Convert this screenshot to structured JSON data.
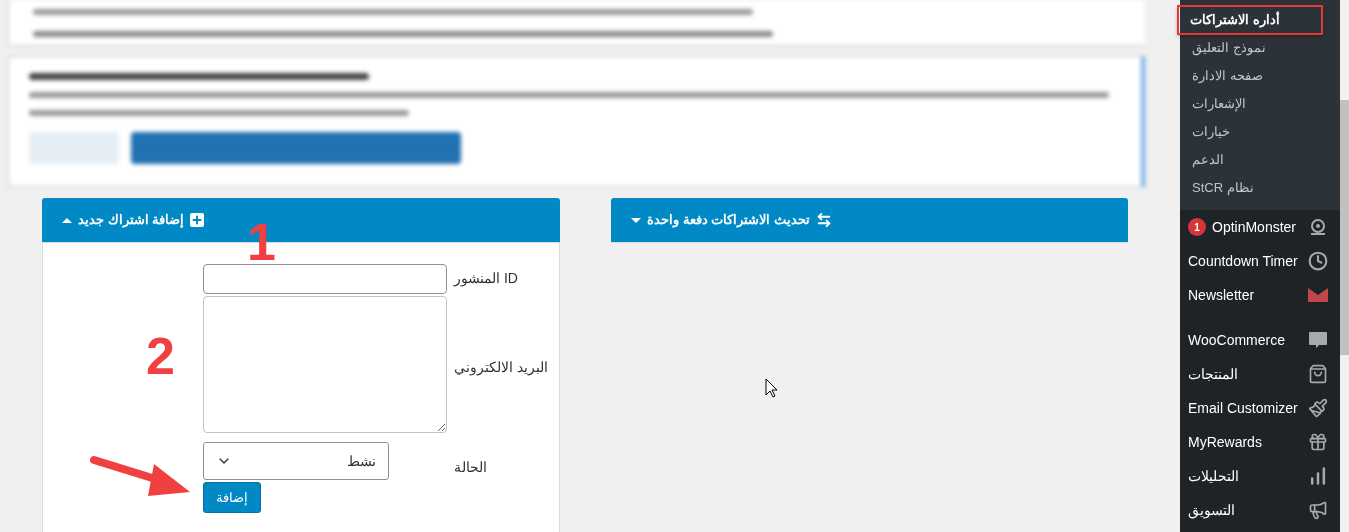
{
  "panels": [
    {
      "title": "تحديث الاشتراكات دفعة واحدة",
      "expanded": false
    },
    {
      "title": "إضافة اشتراك جديد",
      "expanded": true,
      "fields": [
        {
          "kind": "input",
          "label": "ID المنشور"
        },
        {
          "kind": "textarea",
          "label": "البريد الالكتروني"
        },
        {
          "kind": "select",
          "label": "الحالة",
          "value": "نشط"
        }
      ],
      "submit": "إضافة",
      "annotations": [
        {
          "kind": "number",
          "text": "1"
        },
        {
          "kind": "number",
          "text": "2"
        },
        {
          "kind": "arrow"
        }
      ]
    }
  ],
  "sidebar": {
    "submenu": [
      {
        "label": "أداره الاشتراكات",
        "selected": true,
        "highlight": true
      },
      {
        "label": "نموذج التعليق",
        "selected": false,
        "highlight": false
      },
      {
        "label": "صفحه الادارة",
        "selected": false,
        "highlight": false
      },
      {
        "label": "الإشعارات",
        "selected": false,
        "highlight": false
      },
      {
        "label": "خيارات",
        "selected": false,
        "highlight": false
      },
      {
        "label": "الدعم",
        "selected": false,
        "highlight": false
      },
      {
        "label": "نظام StCR",
        "selected": false,
        "highlight": false
      }
    ],
    "menu_groups": [
      [
        {
          "label": "OptinMonster",
          "badge": "1"
        },
        {
          "label": "Countdown Timer"
        },
        {
          "label": "Newsletter"
        }
      ],
      [
        {
          "label": "WooCommerce"
        },
        {
          "label": "المنتجات"
        },
        {
          "label": "Email Customizer"
        },
        {
          "label": "MyRewards"
        },
        {
          "label": "التحليلات"
        },
        {
          "label": "التسويق"
        }
      ]
    ]
  }
}
